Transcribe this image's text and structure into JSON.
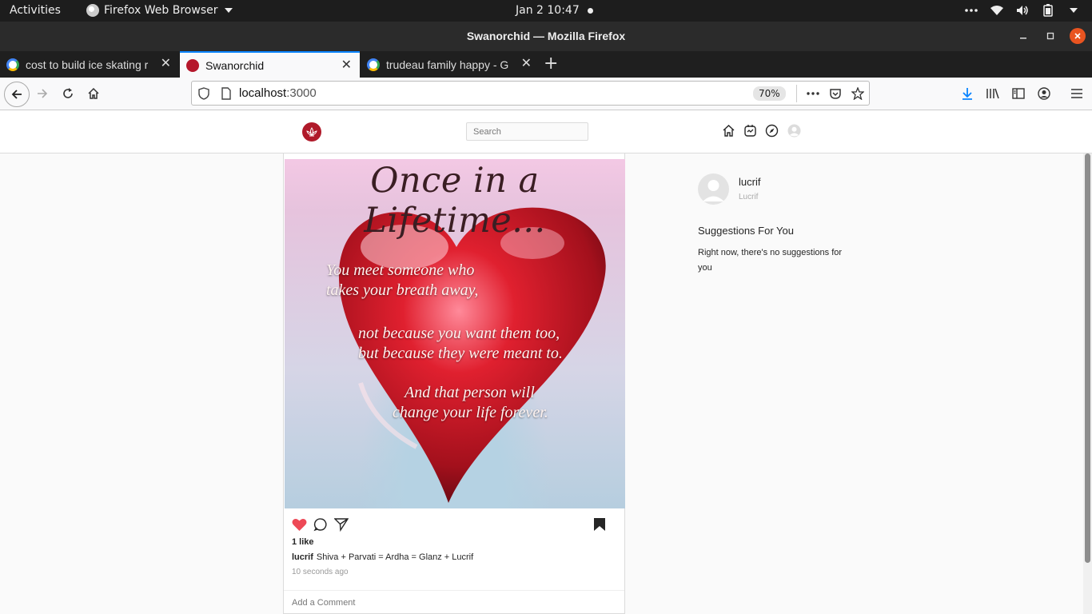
{
  "os": {
    "activities": "Activities",
    "app_name": "Firefox Web Browser",
    "clock": "Jan 2  10:47"
  },
  "window": {
    "title": "Swanorchid — Mozilla Firefox"
  },
  "tabs": [
    {
      "title": "cost to build ice skating r",
      "favicon": "google-icon",
      "active": false
    },
    {
      "title": "Swanorchid",
      "favicon": "swanorchid-icon",
      "active": true
    },
    {
      "title": "trudeau family happy - G",
      "favicon": "google-icon",
      "active": false
    }
  ],
  "navbar": {
    "url_host": "localhost",
    "url_port": ":3000",
    "zoom": "70%"
  },
  "app": {
    "search_placeholder": "Search",
    "brand_color": "#b01a2a"
  },
  "post": {
    "image_text": {
      "heading": "Once in a Lifetime...",
      "lines": [
        "You meet someone who",
        "takes your breath away,",
        "not because you want them too,",
        "but because they were meant to.",
        "And that person will",
        "change your life forever."
      ]
    },
    "likes": "1 like",
    "caption_user": "lucrif",
    "caption_text": "Shiva + Parvati = Ardha = Glanz + Lucrif",
    "time": "10 seconds ago",
    "comment_placeholder": "Add a Comment",
    "liked": true,
    "like_color": "#ed4956"
  },
  "sidebar": {
    "username": "lucrif",
    "fullname": "Lucrif",
    "suggestions_title": "Suggestions For You",
    "suggestions_text": "Right now, there's no suggestions for you"
  }
}
